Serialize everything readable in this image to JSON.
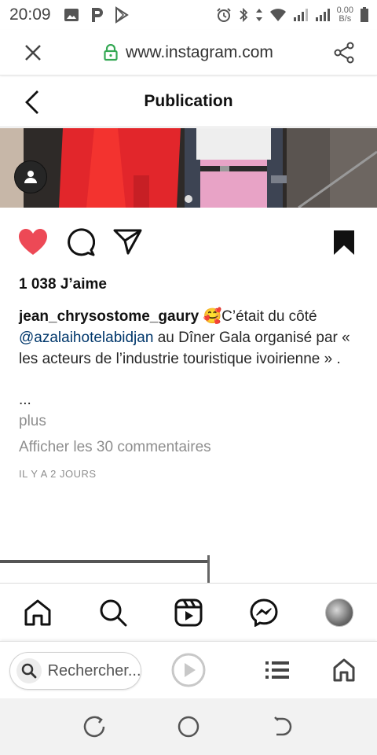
{
  "status_bar": {
    "time": "20:09",
    "net_speed_value": "0.00",
    "net_speed_unit": "B/s",
    "left_icons": [
      "image-icon",
      "p-app-icon",
      "play-store-icon"
    ],
    "right_icons": [
      "alarm-icon",
      "bluetooth-icon",
      "data-arrows-icon",
      "wifi-icon",
      "signal-icon",
      "signal-icon",
      "battery-icon"
    ]
  },
  "browser": {
    "url": "www.instagram.com",
    "search_placeholder": "Rechercher...",
    "icons": [
      "close-icon",
      "lock-icon",
      "share-icon",
      "search-icon",
      "play-icon",
      "list-icon",
      "home-icon"
    ]
  },
  "header": {
    "title": "Publication"
  },
  "post": {
    "likes": "1 038 J’aime",
    "username": "jean_chrysostome_gaury",
    "emoji": "🥰",
    "caption_part1": "C’était du côté",
    "mention": "@azalaihotelabidjan",
    "caption_part2": " au Dîner Gala organisé par « les acteurs de l’industrie touristique ivoirienne » .",
    "ellipsis": "...",
    "more_label": "plus",
    "comments_label": "Afficher les 30 commentaires",
    "time_ago": "IL Y A 2 JOURS"
  },
  "ig_nav": {
    "items": [
      "home-icon",
      "search-icon",
      "reels-icon",
      "messenger-icon",
      "profile-avatar"
    ]
  },
  "system_nav": [
    "recents-icon",
    "home-circle-icon",
    "back-icon"
  ],
  "colors": {
    "like_red": "#ed4956",
    "mention_blue": "#00376b",
    "muted_gray": "#8e8e8e",
    "lock_green": "#34a853"
  }
}
